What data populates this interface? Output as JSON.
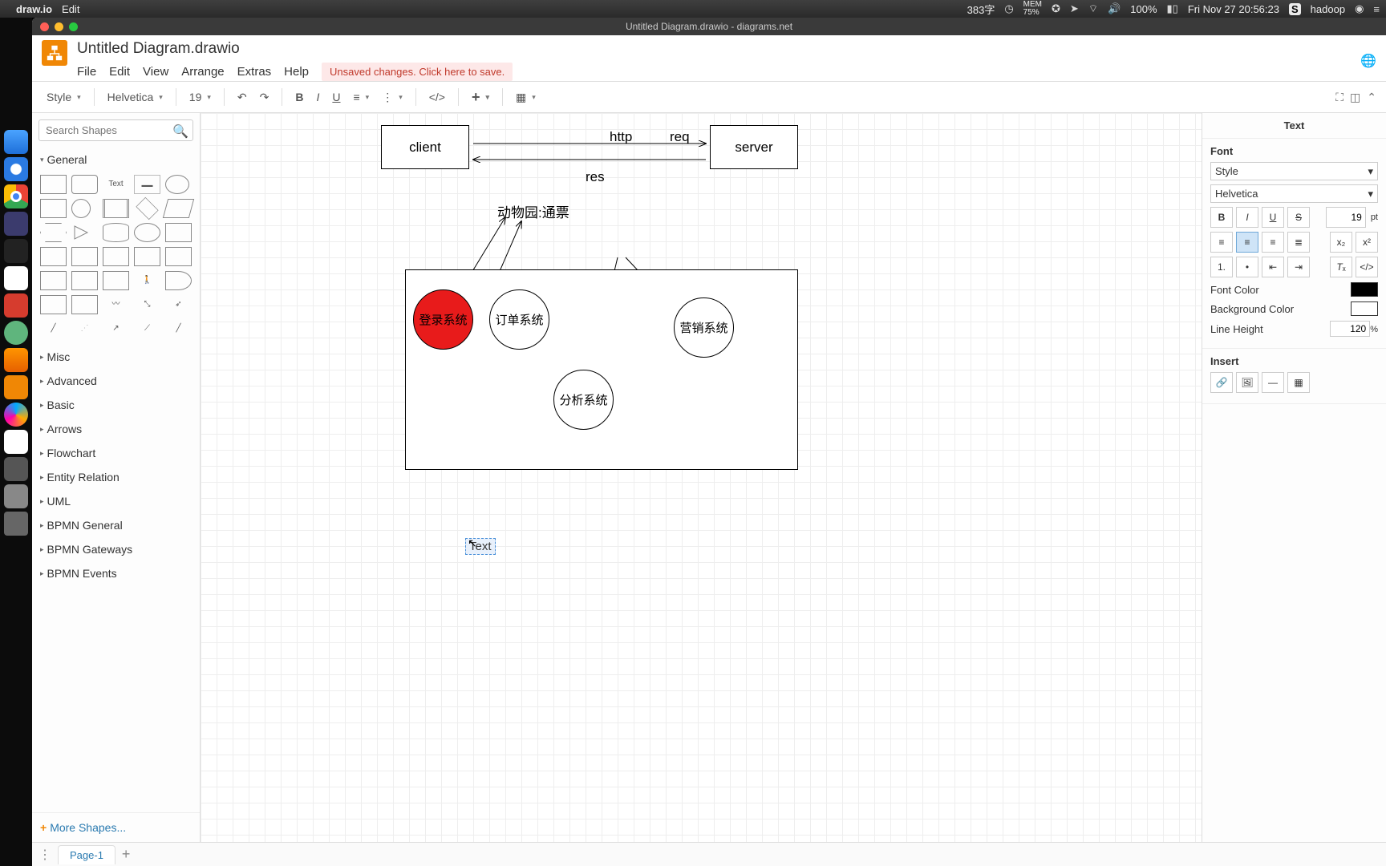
{
  "mac": {
    "app": "draw.io",
    "menu_edit": "Edit",
    "input": "383字",
    "mem": "75%",
    "mem_label": "MEM",
    "battery": "100%",
    "datetime": "Fri Nov 27  20:56:23",
    "user": "hadoop"
  },
  "window": {
    "title": "Untitled Diagram.drawio - diagrams.net"
  },
  "header": {
    "doc_title": "Untitled Diagram.drawio",
    "menus": [
      "File",
      "Edit",
      "View",
      "Arrange",
      "Extras",
      "Help"
    ],
    "unsaved": "Unsaved changes. Click here to save."
  },
  "toolbar": {
    "style": "Style",
    "font": "Helvetica",
    "size": "19"
  },
  "left": {
    "search_placeholder": "Search Shapes",
    "cat_general": "General",
    "cats": [
      "Misc",
      "Advanced",
      "Basic",
      "Arrows",
      "Flowchart",
      "Entity Relation",
      "UML",
      "BPMN General",
      "BPMN Gateways",
      "BPMN Events"
    ],
    "more": "More Shapes..."
  },
  "canvas": {
    "client": "client",
    "server": "server",
    "http": "http",
    "req": "req",
    "res": "res",
    "zoo": "动物园:通票",
    "login": "登录系统",
    "order": "订单系统",
    "analysis": "分析系统",
    "marketing": "营销系统",
    "text_el": "Text"
  },
  "tabs": {
    "page1": "Page-1"
  },
  "right": {
    "title": "Text",
    "font_h": "Font",
    "style": "Style",
    "family": "Helvetica",
    "size": "19",
    "size_unit": "pt",
    "fontcolor": "Font Color",
    "bgcolor": "Background Color",
    "lineheight": "Line Height",
    "lineheight_val": "120",
    "lineheight_unit": "%",
    "insert": "Insert"
  }
}
